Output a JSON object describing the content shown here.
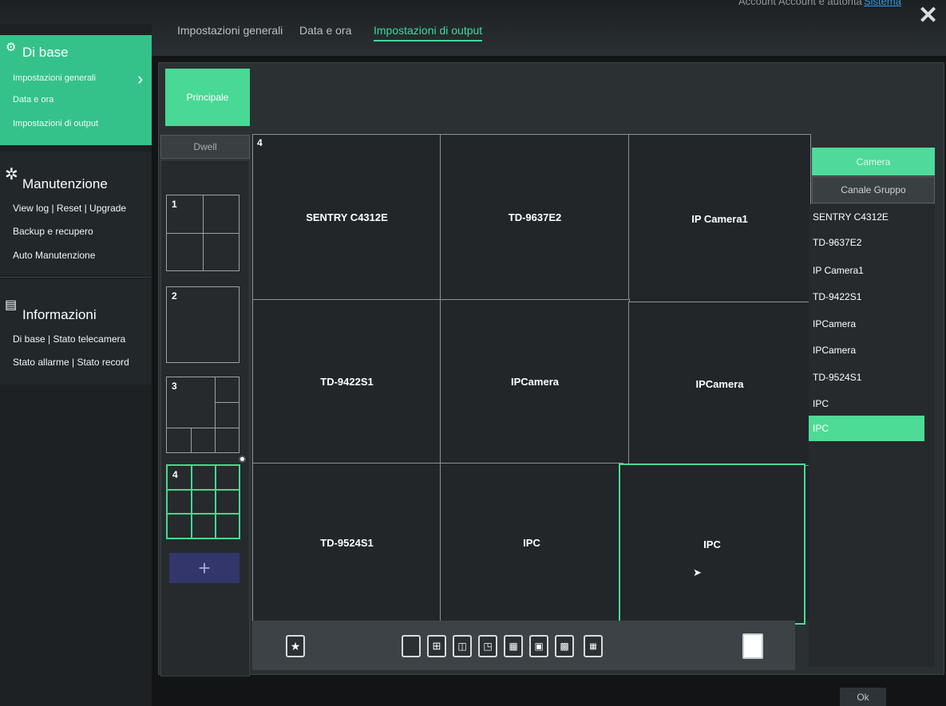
{
  "top_tabs": [
    "Impostazioni generali",
    "Data e ora",
    "Impostazioni di output"
  ],
  "top_nav": {
    "item1": "Account e autorità",
    "system": "Sistema",
    "partial": "Account"
  },
  "sidebar": {
    "base": {
      "title": "Di base",
      "items": [
        "Impostazioni generali",
        "Data e ora",
        "Impostazioni di output"
      ]
    },
    "maintenance": {
      "title": "Manutenzione",
      "line1": "View log | Reset | Upgrade",
      "line2": "Backup e recupero",
      "line3": "Auto Manutenzione"
    },
    "info": {
      "title": "Informazioni",
      "line1": "Di base | Stato telecamera",
      "line2": "Stato allarme | Stato record"
    }
  },
  "output": {
    "tab": "Principale",
    "dwell": "Dwell",
    "layouts": [
      {
        "num": "1"
      },
      {
        "num": "2"
      },
      {
        "num": "3"
      },
      {
        "num": "4"
      }
    ],
    "add": "+",
    "grid_number": "4",
    "cells": [
      "SENTRY C4312E",
      "TD-9637E2",
      "IP Camera1",
      "TD-9422S1",
      "IPCamera",
      "IPCamera",
      "TD-9524S1",
      "IPC",
      "IPC"
    ],
    "toolbar_layout_icons": [
      "1",
      "4",
      "6",
      "8",
      "9",
      "13",
      "16"
    ]
  },
  "right_panel": {
    "camera_tab": "Camera",
    "group_tab": "Canale Gruppo",
    "cameras": [
      "SENTRY C4312E",
      "TD-9637E2",
      "IP Camera1",
      "TD-9422S1",
      "IPCamera",
      "IPCamera",
      "TD-9524S1",
      "IPC",
      "IPC"
    ],
    "selected_index": 8
  },
  "ok": "Ok",
  "colors": {
    "accent": "#44d98f",
    "background": "#121416"
  }
}
